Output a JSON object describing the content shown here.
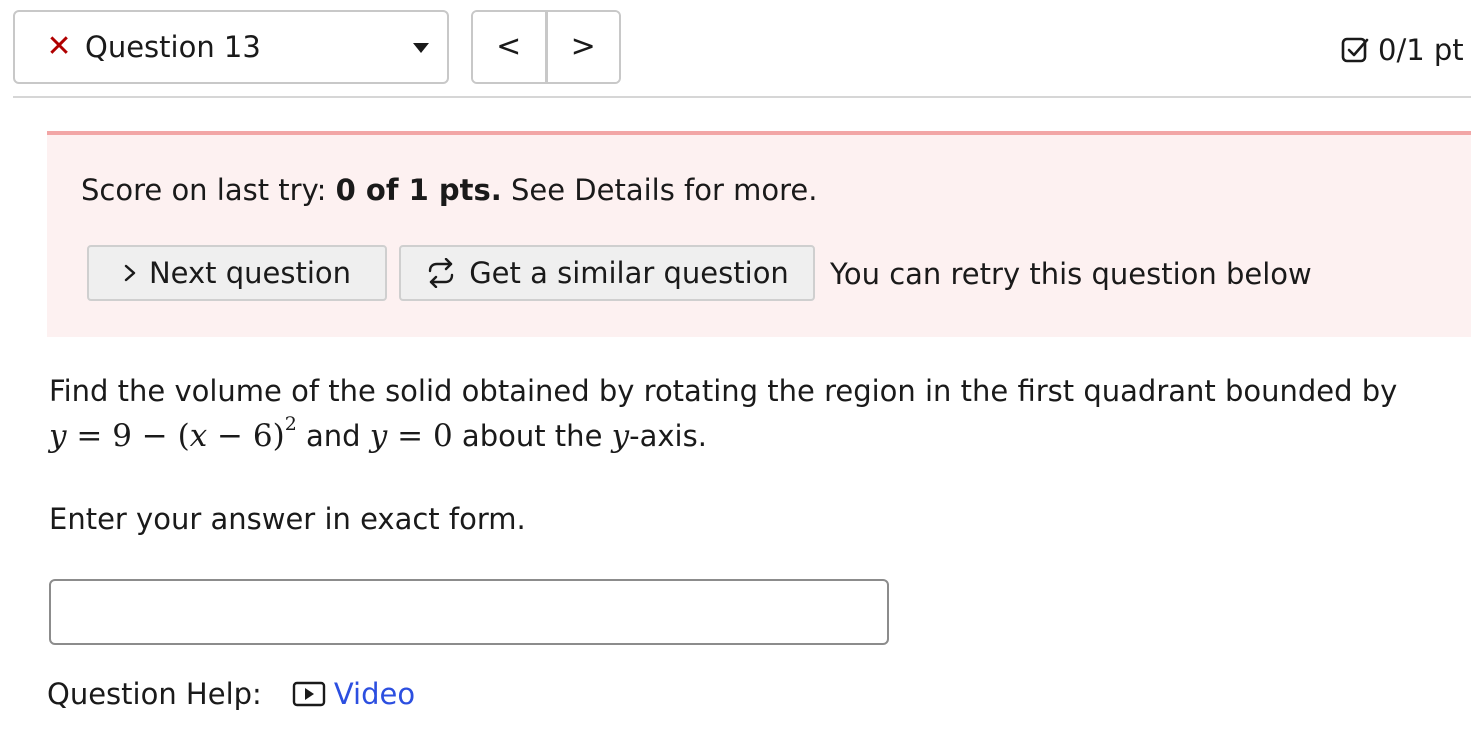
{
  "header": {
    "question_label": "Question 13",
    "status_icon": "x-icon",
    "prev_label": "<",
    "next_label": ">",
    "points": "0/1 pt",
    "points_icon": "checkbox-icon"
  },
  "score_banner": {
    "prefix": "Score on last try: ",
    "score": "0 of 1 pts.",
    "suffix": " See Details for more.",
    "next_button": "Next question",
    "similar_button": "Get a similar question",
    "retry_note": "You can retry this question below"
  },
  "question": {
    "line1": "Find the volume of the solid obtained by rotating the region in the first quadrant bounded by",
    "math1_lhs": "y",
    "math1_rhs": " = 9 − (",
    "math1_var": "x",
    "math1_tail": " − 6)",
    "math1_exp": "2",
    "and_text": " and ",
    "math2_lhs": "y",
    "math2_rhs": " = 0",
    "about_text": " about the ",
    "axis_var": "y",
    "axis_suffix": "-axis.",
    "instruction": "Enter your answer in exact form.",
    "answer_value": ""
  },
  "help": {
    "label": "Question Help:",
    "video_label": "Video"
  },
  "colors": {
    "error_red": "#b00000",
    "banner_bg": "#fdf1f1",
    "banner_border": "#f2a6a6",
    "link_blue": "#2c4fe0"
  }
}
